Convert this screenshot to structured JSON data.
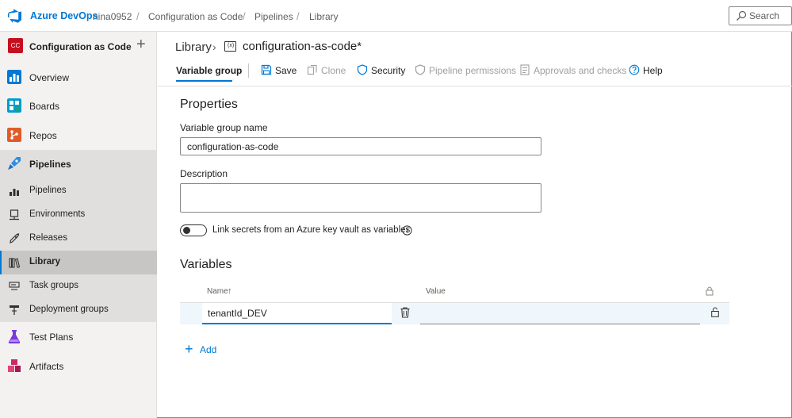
{
  "topbar": {
    "brand": "Azure DevOps",
    "breadcrumbs": [
      "nina0952",
      "Configuration as Code",
      "Pipelines",
      "Library"
    ],
    "search_placeholder": "Search"
  },
  "sidebar": {
    "project_badge": "CC",
    "project_name": "Configuration as Code",
    "items": [
      {
        "label": "Overview",
        "icon": "overview-icon",
        "color": "#0078d4"
      },
      {
        "label": "Boards",
        "icon": "boards-icon",
        "color": "#009ccc"
      },
      {
        "label": "Repos",
        "icon": "repos-icon",
        "color": "#e05b29"
      },
      {
        "label": "Pipelines",
        "icon": "pipelines-icon",
        "color": "#1e6bc9"
      },
      {
        "label": "Test Plans",
        "icon": "test-plans-icon",
        "color": "#773adc"
      },
      {
        "label": "Artifacts",
        "icon": "artifacts-icon",
        "color": "#cc2966"
      }
    ],
    "pipeline_subitems": [
      {
        "label": "Pipelines",
        "icon": "pipelines-sub-icon"
      },
      {
        "label": "Environments",
        "icon": "environments-icon"
      },
      {
        "label": "Releases",
        "icon": "releases-icon"
      },
      {
        "label": "Library",
        "icon": "library-icon",
        "active": true
      },
      {
        "label": "Task groups",
        "icon": "task-groups-icon"
      },
      {
        "label": "Deployment groups",
        "icon": "deployment-groups-icon"
      }
    ]
  },
  "header": {
    "library_link": "Library",
    "title": "configuration-as-code*"
  },
  "toolbar": {
    "tab_label": "Variable group",
    "save": "Save",
    "clone": "Clone",
    "security": "Security",
    "pipeline_permissions": "Pipeline permissions",
    "approvals": "Approvals and checks",
    "help": "Help"
  },
  "properties": {
    "section_title": "Properties",
    "name_label": "Variable group name",
    "name_value": "configuration-as-code",
    "description_label": "Description",
    "description_value": "",
    "toggle_label": "Link secrets from an Azure key vault as variables",
    "toggle_on": false
  },
  "variables": {
    "section_title": "Variables",
    "col_name": "Name",
    "col_name_sort": "↑",
    "col_value": "Value",
    "rows": [
      {
        "name": "tenantId_DEV",
        "value": ""
      }
    ],
    "add_label": "Add"
  },
  "colors": {
    "accent": "#0078d4",
    "sidebar_bg": "#f3f2f1",
    "selected_row": "#eff6fc"
  }
}
